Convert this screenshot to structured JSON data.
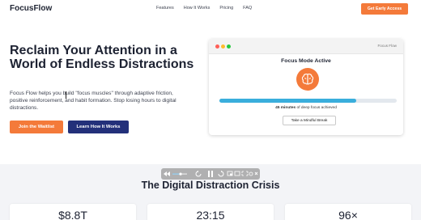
{
  "nav": {
    "logo": "FocusFlow",
    "links": [
      "Features",
      "How It Works",
      "Pricing",
      "FAQ"
    ],
    "cta": "Get Early Access"
  },
  "hero": {
    "title": "Reclaim Your Attention in a World of Endless Distractions",
    "description": "Focus Flow helps you build \"focus muscles\" through adaptive friction, positive reinforcement, and habit formation. Stop losing hours to digital distractions.",
    "primary_button": "Join the Waitlist",
    "secondary_button": "Learn How It Works"
  },
  "app_card": {
    "window_title": "Focus Flow",
    "heading": "Focus Mode Active",
    "progress_fraction": 0.77,
    "minutes_value": "45 minutes",
    "minutes_suffix": " of deep focus achieved",
    "break_button": "Take a Mindful Break",
    "colors": {
      "accent": "#f47a3a",
      "progress": "#3aaedc"
    },
    "icon": "brain-icon"
  },
  "crisis": {
    "title": "The Digital Distraction Crisis",
    "stats": [
      "$8.8T",
      "23:15",
      "96×"
    ]
  },
  "media_overlay": {
    "icons": [
      "rewind-icon",
      "volume-icon",
      "rewind-10-icon",
      "pause-icon",
      "forward-10-icon",
      "pip-icon",
      "captions-icon",
      "fullscreen-icon",
      "settings-icon",
      "close-icon"
    ]
  }
}
